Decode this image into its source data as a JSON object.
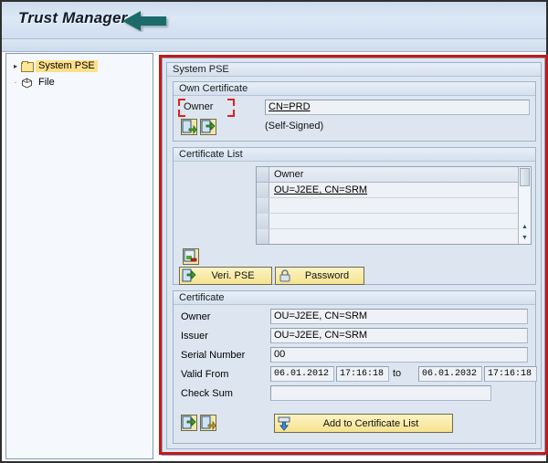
{
  "window": {
    "title": "Trust Manager",
    "arrow_color": "#1f6b6b",
    "annotation_color": "#c21a1a"
  },
  "sidebar": {
    "items": [
      {
        "label": "System PSE",
        "icon": "folder-icon",
        "selected": true,
        "twisty": "▸"
      },
      {
        "label": "File",
        "icon": "file-pse-icon",
        "selected": false,
        "twisty": "·"
      }
    ]
  },
  "main": {
    "group_title": "System PSE",
    "own_certificate": {
      "group_title": "Own Certificate",
      "owner_label": "Owner",
      "owner_value": "CN=PRD",
      "self_signed_text": "(Self-Signed)",
      "icons": [
        {
          "name": "import-certificate-icon"
        },
        {
          "name": "export-certificate-icon"
        }
      ]
    },
    "certificate_list": {
      "group_title": "Certificate List",
      "column_header": "Owner",
      "rows": [
        {
          "owner": "OU=J2EE, CN=SRM"
        },
        {
          "owner": ""
        },
        {
          "owner": ""
        },
        {
          "owner": ""
        }
      ],
      "scroll_up": "▲",
      "scroll_down": "▼",
      "delete_icon_name": "remove-from-list-icon",
      "buttons": [
        {
          "label": "Veri. PSE",
          "icon": "verify-pse-icon"
        },
        {
          "label": "Password",
          "icon": "lock-icon"
        }
      ]
    },
    "certificate": {
      "group_title": "Certificate",
      "fields": [
        {
          "label": "Owner",
          "value": "OU=J2EE, CN=SRM"
        },
        {
          "label": "Issuer",
          "value": "OU=J2EE, CN=SRM"
        },
        {
          "label": "Serial Number",
          "value": "00"
        }
      ],
      "valid_from": {
        "label": "Valid From",
        "from_date": "06.01.2012",
        "from_time": "17:16:18",
        "separator": "to",
        "to_date": "06.01.2032",
        "to_time": "17:16:18"
      },
      "check_sum": {
        "label": "Check Sum",
        "value": ""
      },
      "footer_icons": [
        {
          "name": "export-certificate-icon"
        },
        {
          "name": "import-certificate-icon"
        }
      ],
      "add_button": {
        "label": "Add to Certificate List",
        "icon": "add-to-list-icon"
      }
    }
  }
}
